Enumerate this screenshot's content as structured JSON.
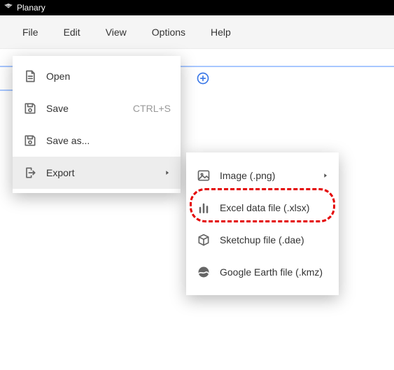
{
  "titlebar": {
    "app_name": "Planary"
  },
  "menubar": {
    "items": [
      {
        "label": "File"
      },
      {
        "label": "Edit"
      },
      {
        "label": "View"
      },
      {
        "label": "Options"
      },
      {
        "label": "Help"
      }
    ]
  },
  "file_menu": {
    "open": {
      "label": "Open"
    },
    "save": {
      "label": "Save",
      "shortcut": "CTRL+S"
    },
    "save_as": {
      "label": "Save as..."
    },
    "export": {
      "label": "Export"
    }
  },
  "export_menu": {
    "image": {
      "label": "Image (.png)"
    },
    "excel": {
      "label": "Excel data file (.xlsx)"
    },
    "sketchup": {
      "label": "Sketchup file (.dae)"
    },
    "googleearth": {
      "label": "Google Earth file (.kmz)"
    }
  }
}
